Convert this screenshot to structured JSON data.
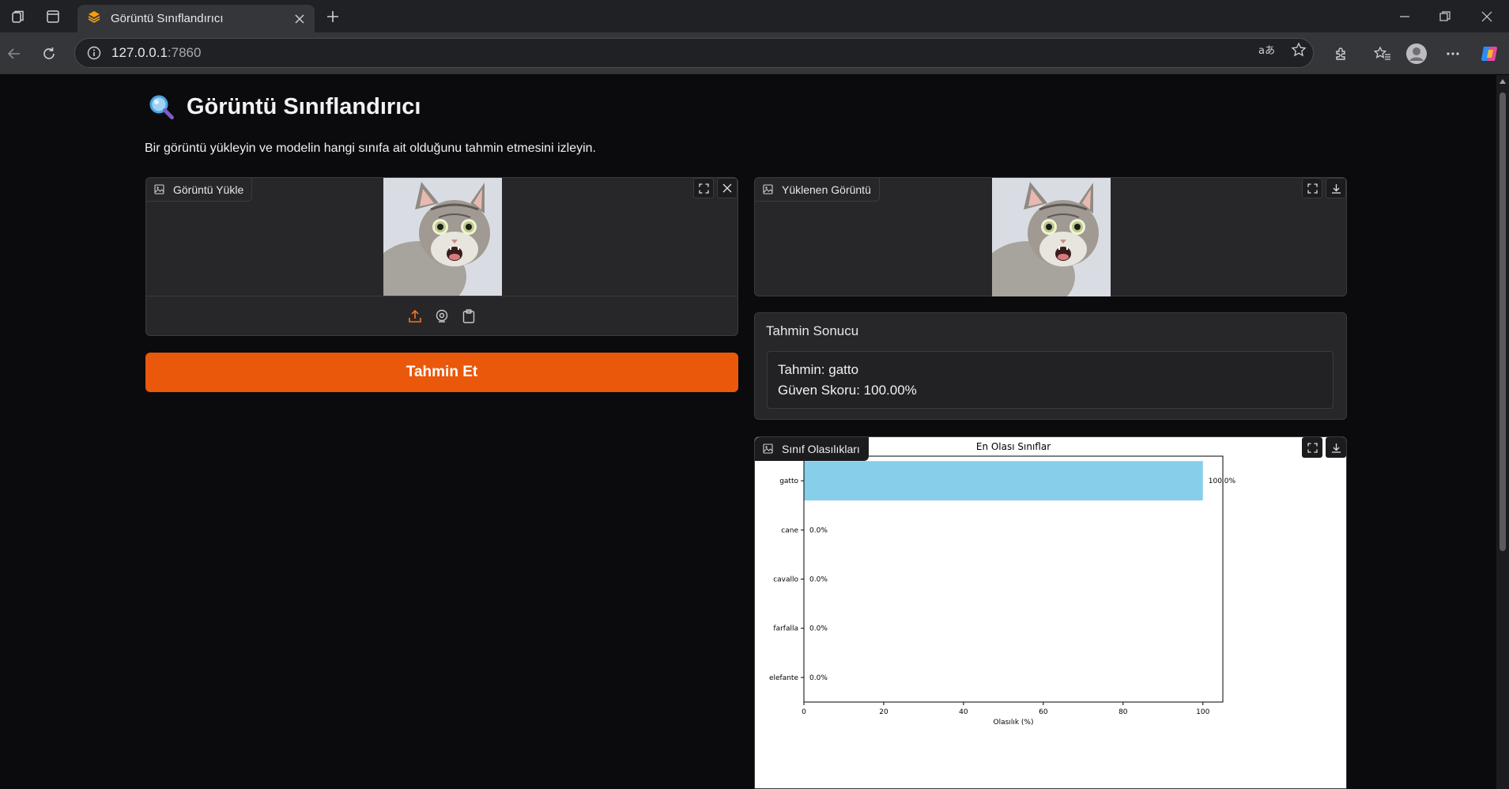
{
  "browser": {
    "tab_title": "Görüntü Sınıflandırıcı",
    "url_host": "127.0.0.1",
    "url_port": ":7860"
  },
  "app": {
    "title": "Görüntü Sınıflandırıcı",
    "title_icon": "magnifier-icon",
    "description": "Bir görüntü yükleyin ve modelin hangi sınıfa ait olduğunu tahmin etmesini izleyin."
  },
  "upload_panel": {
    "label": "Görüntü Yükle"
  },
  "predict_button": {
    "label": "Tahmin Et",
    "color": "#ea580c"
  },
  "uploaded_panel": {
    "label": "Yüklenen Görüntü"
  },
  "result_panel": {
    "label": "Tahmin Sonucu",
    "lines": [
      "Tahmin: gatto",
      "Güven Skoru: 100.00%"
    ]
  },
  "chart_panel": {
    "label": "Sınıf Olasılıkları"
  },
  "chart_data": {
    "type": "bar",
    "orientation": "horizontal",
    "title": "En Olası Sınıflar",
    "xlabel": "Olasılık (%)",
    "ylabel": "",
    "categories": [
      "gatto",
      "cane",
      "cavallo",
      "farfalla",
      "elefante"
    ],
    "values": [
      100.0,
      0.0,
      0.0,
      0.0,
      0.0
    ],
    "value_labels": [
      "100.0%",
      "0.0%",
      "0.0%",
      "0.0%",
      "0.0%"
    ],
    "xlim": [
      0,
      105
    ],
    "xticks": [
      0,
      20,
      40,
      60,
      80,
      100
    ],
    "bar_color": "#87ceeb",
    "grid": false
  }
}
